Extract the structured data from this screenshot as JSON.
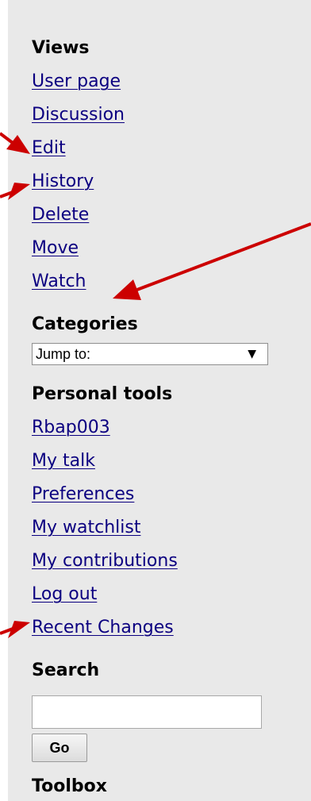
{
  "sidebar": {
    "views": {
      "heading": "Views",
      "links": [
        "User page",
        "Discussion",
        "Edit",
        "History",
        "Delete",
        "Move",
        "Watch"
      ]
    },
    "categories": {
      "heading": "Categories",
      "select_value": "Jump to:",
      "arrow_glyph": "▼"
    },
    "personal_tools": {
      "heading": "Personal tools",
      "links": [
        "Rbap003",
        "My talk",
        "Preferences",
        "My watchlist",
        "My contributions",
        "Log out",
        "Recent Changes"
      ]
    },
    "search": {
      "heading": "Search",
      "input_value": "",
      "go_label": "Go"
    },
    "toolbox": {
      "heading": "Toolbox"
    }
  },
  "colors": {
    "sidebar_bg": "#e9e9e9",
    "link": "#0b0080",
    "annotation_arrow": "#cc0000"
  },
  "annotations": {
    "arrow_icon": "annotation-arrow-icon"
  }
}
